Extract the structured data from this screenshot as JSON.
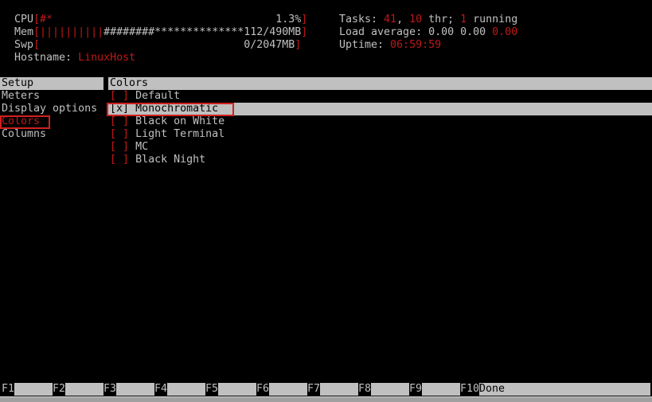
{
  "header": {
    "cpu": {
      "label": "CPU",
      "bar_red": "#*",
      "value": "1.3%"
    },
    "mem": {
      "label": "Mem",
      "bar_red": "||||||||||",
      "bar_hash": "########",
      "bar_star": "**************",
      "value": "112/490MB"
    },
    "swp": {
      "label": "Swp",
      "value": "0/2047MB"
    },
    "hostname": {
      "label": "Hostname: ",
      "value": "LinuxHost"
    },
    "tasks": {
      "label": "Tasks: ",
      "count": "41",
      "sep1": ", ",
      "threads": "10",
      "sep2": " thr; ",
      "running": "1",
      "suffix": " running"
    },
    "load": {
      "label": "Load average: ",
      "v1": "0.00",
      "v2": "0.00",
      "v3": "0.00"
    },
    "uptime": {
      "label": "Uptime: ",
      "value": "06:59:59"
    }
  },
  "setup": {
    "title": "Setup",
    "items": [
      {
        "label": "Meters"
      },
      {
        "label": "Display options"
      },
      {
        "label": "Colors"
      },
      {
        "label": "Columns"
      }
    ],
    "selected": "Colors"
  },
  "colors": {
    "title": "Colors",
    "options": [
      {
        "mark": " ",
        "label": "Default"
      },
      {
        "mark": "x",
        "label": "Monochromatic"
      },
      {
        "mark": " ",
        "label": "Black on White"
      },
      {
        "mark": " ",
        "label": "Light Terminal"
      },
      {
        "mark": " ",
        "label": "MC"
      },
      {
        "mark": " ",
        "label": "Black Night"
      }
    ]
  },
  "footer": [
    {
      "key": "F1",
      "label": ""
    },
    {
      "key": "F2",
      "label": ""
    },
    {
      "key": "F3",
      "label": ""
    },
    {
      "key": "F4",
      "label": ""
    },
    {
      "key": "F5",
      "label": ""
    },
    {
      "key": "F6",
      "label": ""
    },
    {
      "key": "F7",
      "label": ""
    },
    {
      "key": "F8",
      "label": ""
    },
    {
      "key": "F9",
      "label": ""
    },
    {
      "key": "F10",
      "label": "Done"
    }
  ],
  "colors_theme": {
    "text": "#c0c0c0",
    "accent_red": "#c01818",
    "highlight": "#c0c0c0",
    "annotation_box": "#d02020"
  }
}
